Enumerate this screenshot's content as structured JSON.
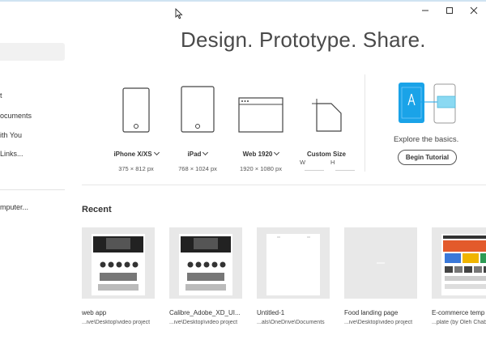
{
  "window": {
    "controls": [
      "minimize",
      "maximize",
      "close"
    ]
  },
  "sidebar": {
    "items": [
      {
        "label": "t"
      },
      {
        "label": "ocuments"
      },
      {
        "label": "ith You"
      },
      {
        "label": "Links..."
      },
      {
        "label": "mputer..."
      }
    ]
  },
  "hero": {
    "title": "Design. Prototype. Share."
  },
  "presets": [
    {
      "label": "iPhone X/XS",
      "size": "375 × 812 px",
      "icon": "phone-icon"
    },
    {
      "label": "iPad",
      "size": "768 × 1024 px",
      "icon": "tablet-icon"
    },
    {
      "label": "Web 1920",
      "size": "1920 × 1080 px",
      "icon": "browser-window-icon"
    },
    {
      "label": "Custom Size",
      "w_label": "W",
      "h_label": "H",
      "icon": "custom-size-icon"
    }
  ],
  "explore": {
    "text": "Explore the basics.",
    "button": "Begin Tutorial",
    "accent": "#1aa3e8"
  },
  "recent": {
    "title": "Recent",
    "files": [
      {
        "name": "web app",
        "path": "...ive\\Desktop\\video project"
      },
      {
        "name": "Calibre_Adobe_XD_UI...",
        "path": "...ive\\Desktop\\video project"
      },
      {
        "name": "Untitled-1",
        "path": "...als\\OneDrive\\Documents"
      },
      {
        "name": "Food landing page",
        "path": "...ive\\Desktop\\video project"
      },
      {
        "name": "E-commerce temp",
        "path": "...plate (by Oleh Chab"
      }
    ]
  }
}
